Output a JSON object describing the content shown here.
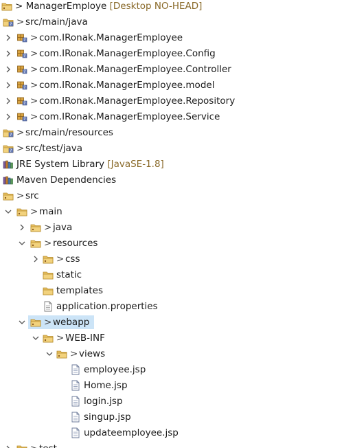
{
  "explorer": {
    "rows": [
      {
        "text": "> ManagerEmploye",
        "deco": " [Desktop NO-HEAD]",
        "icon": "project-icon",
        "chevron": "none"
      },
      {
        "text": "src/main/java",
        "icon": "source-folder-icon",
        "chevron": "none",
        "gt": true
      },
      {
        "text": "com.IRonak.ManagerEmployee",
        "icon": "package-icon",
        "chevron": "right",
        "gt": true
      },
      {
        "text": "com.IRonak.ManagerEmployee.Config",
        "icon": "package-icon",
        "chevron": "right",
        "gt": true
      },
      {
        "text": "com.IRonak.ManagerEmployee.Controller",
        "icon": "package-icon",
        "chevron": "right",
        "gt": true
      },
      {
        "text": "com.IRonak.ManagerEmployee.model",
        "icon": "package-icon",
        "chevron": "right",
        "gt": true
      },
      {
        "text": "com.IRonak.ManagerEmployee.Repository",
        "icon": "package-icon",
        "chevron": "right",
        "gt": true
      },
      {
        "text": "com.IRonak.ManagerEmployee.Service",
        "icon": "package-icon",
        "chevron": "right",
        "gt": true
      },
      {
        "text": "src/main/resources",
        "icon": "source-folder-icon",
        "chevron": "none",
        "gt": true
      },
      {
        "text": "src/test/java",
        "icon": "source-folder-icon",
        "chevron": "none",
        "gt": true
      },
      {
        "text": "JRE System Library",
        "deco": " [JavaSE-1.8]",
        "icon": "library-icon",
        "chevron": "none"
      },
      {
        "text": "Maven Dependencies",
        "icon": "library-icon",
        "chevron": "none"
      },
      {
        "text": "src",
        "icon": "folder-icon",
        "chevron": "none",
        "gt": true
      },
      {
        "text": "main",
        "icon": "folder-icon",
        "chevron": "down",
        "gt": true
      },
      {
        "text": "java",
        "icon": "folder-icon",
        "chevron": "right",
        "gt": true
      },
      {
        "text": "resources",
        "icon": "folder-icon",
        "chevron": "down",
        "gt": true
      },
      {
        "text": "css",
        "icon": "folder-icon",
        "chevron": "right",
        "gt": true
      },
      {
        "text": "static",
        "icon": "plain-folder-icon",
        "chevron": "none"
      },
      {
        "text": "templates",
        "icon": "plain-folder-icon",
        "chevron": "none"
      },
      {
        "text": "application.properties",
        "icon": "file-icon",
        "chevron": "none"
      },
      {
        "text": "webapp",
        "icon": "folder-icon",
        "chevron": "down",
        "gt": true,
        "selected": true
      },
      {
        "text": "WEB-INF",
        "icon": "folder-icon",
        "chevron": "down",
        "gt": true
      },
      {
        "text": "views",
        "icon": "folder-icon",
        "chevron": "down",
        "gt": true
      },
      {
        "text": "employee.jsp",
        "icon": "jsp-file-icon",
        "chevron": "none"
      },
      {
        "text": "Home.jsp",
        "icon": "jsp-file-icon",
        "chevron": "none"
      },
      {
        "text": "login.jsp",
        "icon": "jsp-file-icon",
        "chevron": "none"
      },
      {
        "text": "singup.jsp",
        "icon": "jsp-file-icon",
        "chevron": "none"
      },
      {
        "text": "updateemployee.jsp",
        "icon": "jsp-file-icon",
        "chevron": "none"
      },
      {
        "text": "test",
        "icon": "folder-icon",
        "chevron": "right",
        "gt": true
      }
    ]
  }
}
